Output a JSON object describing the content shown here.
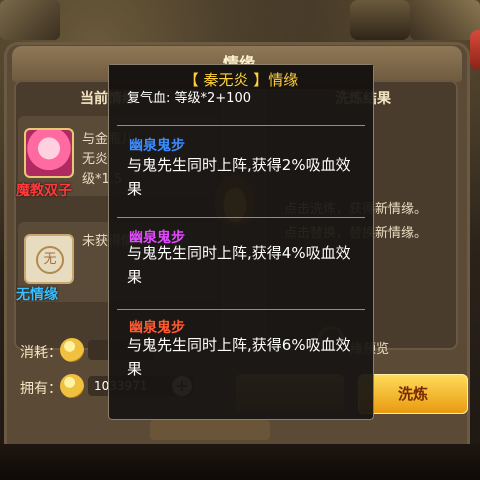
{
  "colors": {
    "tooltip_title": "#ffd23a",
    "section1": "#3a8cff",
    "section2": "#e24aff",
    "section3": "#ff5a30",
    "red_name": "#ff3a3a",
    "blue_name": "#3ac0ff"
  },
  "dialog": {
    "title": "情缘",
    "left_panel_title": "当前情缘",
    "right_panel_title": "洗炼结果",
    "card1": {
      "line1": "与金瓶儿",
      "line2": "无炎",
      "line3": "级*1.5",
      "name": "魔教双子"
    },
    "card2": {
      "line1": "未获得情",
      "name": "无情缘",
      "icon_char": "无"
    },
    "right_hint1": "点击洗炼，获得新情缘。",
    "right_hint2": "点击替换，替换新情缘。",
    "preview_label": "缘预览",
    "consume_label": "消耗：",
    "owned_label": "拥有：",
    "owned_value": "1033971",
    "plus": "+",
    "wash_button": "洗炼"
  },
  "tooltip": {
    "title": "【 秦无炎 】情缘",
    "clipped_line": "复气血: 等级*2+100",
    "sections": [
      {
        "name": "幽泉鬼步",
        "desc": "与鬼先生同时上阵,获得2%吸血效果"
      },
      {
        "name": "幽泉鬼步",
        "desc": "与鬼先生同时上阵,获得4%吸血效果"
      },
      {
        "name": "幽泉鬼步",
        "desc": "与鬼先生同时上阵,获得6%吸血效果"
      }
    ]
  }
}
